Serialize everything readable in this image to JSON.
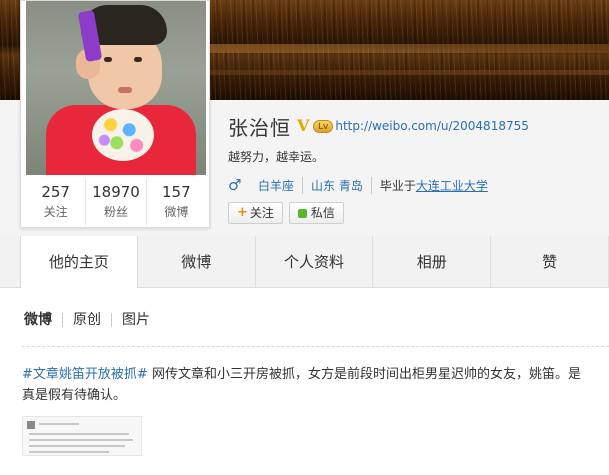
{
  "profile": {
    "name": "张治恒",
    "verified_mark": "V",
    "level_badge": "Lv",
    "url": "http://weibo.com/u/2004818755",
    "motto": "越努力，越幸运。",
    "gender_icon": "male-icon",
    "gender_symbol": "♂",
    "constellation": "白羊座",
    "location": "山东 青岛",
    "education_prefix": "毕业于",
    "school": "大连工业大学"
  },
  "stats": [
    {
      "value": "257",
      "label": "关注"
    },
    {
      "value": "18970",
      "label": "粉丝"
    },
    {
      "value": "157",
      "label": "微博"
    }
  ],
  "buttons": {
    "follow_icon": "+",
    "follow_label": "关注",
    "message_label": "私信"
  },
  "tabs": [
    {
      "label": "他的主页",
      "active": true
    },
    {
      "label": "微博",
      "active": false
    },
    {
      "label": "个人资料",
      "active": false
    },
    {
      "label": "相册",
      "active": false
    },
    {
      "label": "赞",
      "active": false
    }
  ],
  "subtabs": [
    "微博",
    "原创",
    "图片"
  ],
  "post": {
    "hashtag": "#文章姚笛开放被抓#",
    "text": "网传文章和小三开房被抓，女方是前段时间出柜男星迟帅的女友，姚笛。是真是假有待确认。"
  }
}
